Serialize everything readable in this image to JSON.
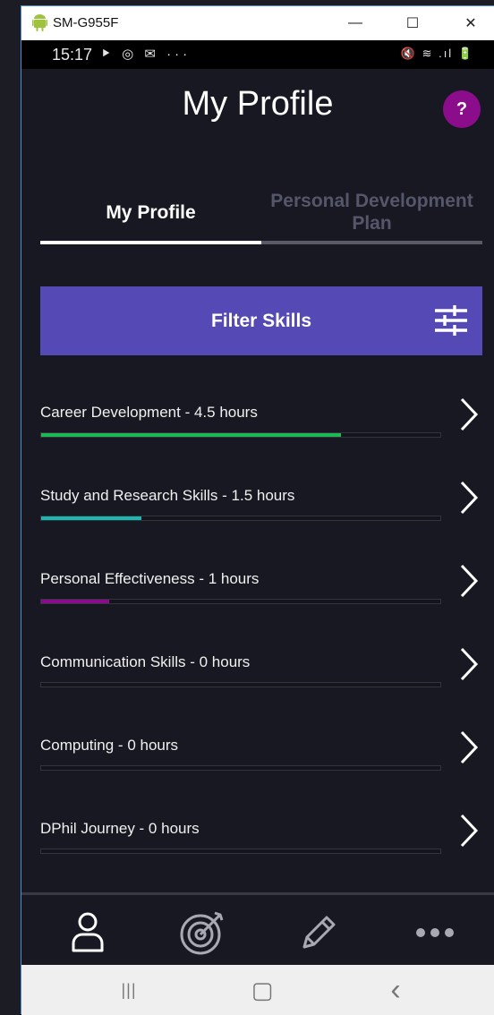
{
  "window": {
    "title": "SM-G955F",
    "minimize_glyph": "—",
    "maximize_glyph": "☐",
    "close_glyph": "✕"
  },
  "status_bar": {
    "time": "15:17",
    "left_icons": "⯈ ◎ ✉ ···",
    "right_icons": "🔇 ≋ .ıl 🔋"
  },
  "header": {
    "title": "My Profile",
    "help_label": "?"
  },
  "tabs": [
    {
      "label": "My Profile",
      "active": true
    },
    {
      "label": "Personal Development Plan",
      "active": false
    }
  ],
  "filter": {
    "label": "Filter Skills",
    "icon": "sliders-icon"
  },
  "skills": [
    {
      "label": "Career Development - 4.5 hours",
      "progress": 0.75,
      "color": "#1db954"
    },
    {
      "label": "Study and Research Skills - 1.5 hours",
      "progress": 0.25,
      "color": "#1ab8b0"
    },
    {
      "label": "Personal Effectiveness - 1 hours",
      "progress": 0.17,
      "color": "#8b0d8b"
    },
    {
      "label": "Communication Skills - 0 hours",
      "progress": 0,
      "color": "#1db954"
    },
    {
      "label": "Computing - 0 hours",
      "progress": 0,
      "color": "#1db954"
    },
    {
      "label": "DPhil Journey - 0 hours",
      "progress": 0,
      "color": "#1db954"
    }
  ],
  "bottom_nav": [
    {
      "icon": "person-icon",
      "active": true
    },
    {
      "icon": "target-icon",
      "active": false
    },
    {
      "icon": "pencil-icon",
      "active": false
    },
    {
      "icon": "more-icon",
      "active": false
    }
  ],
  "system_nav": {
    "recents_glyph": "|||",
    "home_glyph": "▢",
    "back_glyph": "‹"
  },
  "colors": {
    "background": "#181822",
    "accent": "#5549b5",
    "help": "#8b0d8b"
  }
}
